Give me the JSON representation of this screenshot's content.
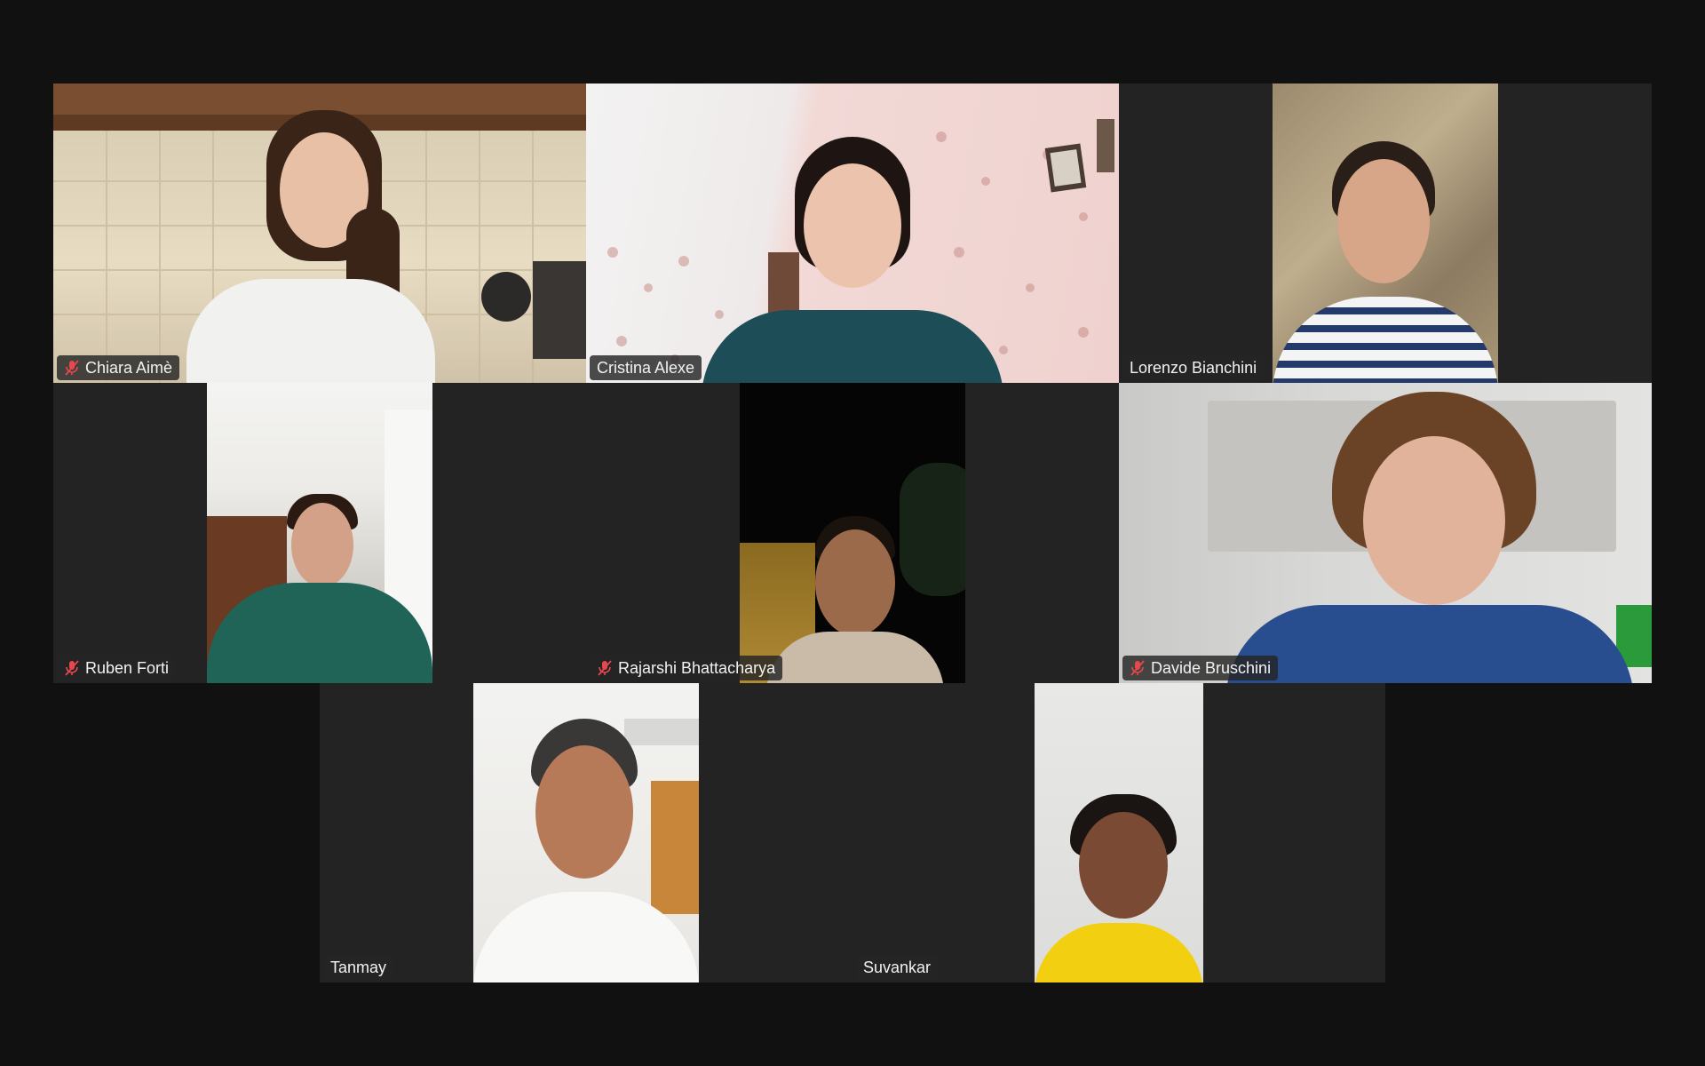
{
  "participants": [
    {
      "name": "Chiara Aimè",
      "muted": true,
      "speaking": false
    },
    {
      "name": "Cristina Alexe",
      "muted": false,
      "speaking": true
    },
    {
      "name": "Lorenzo Bianchini",
      "muted": false,
      "speaking": false
    },
    {
      "name": "Ruben Forti",
      "muted": true,
      "speaking": false
    },
    {
      "name": "Rajarshi Bhattacharya",
      "muted": true,
      "speaking": false
    },
    {
      "name": "Davide Bruschini",
      "muted": true,
      "speaking": false
    },
    {
      "name": "Tanmay",
      "muted": false,
      "speaking": false
    },
    {
      "name": "Suvankar",
      "muted": false,
      "speaking": false
    }
  ],
  "colors": {
    "background": "#111112",
    "tile": "#232323",
    "active_speaker_border": "#2ee08f",
    "mute_icon": "#e5484d"
  }
}
